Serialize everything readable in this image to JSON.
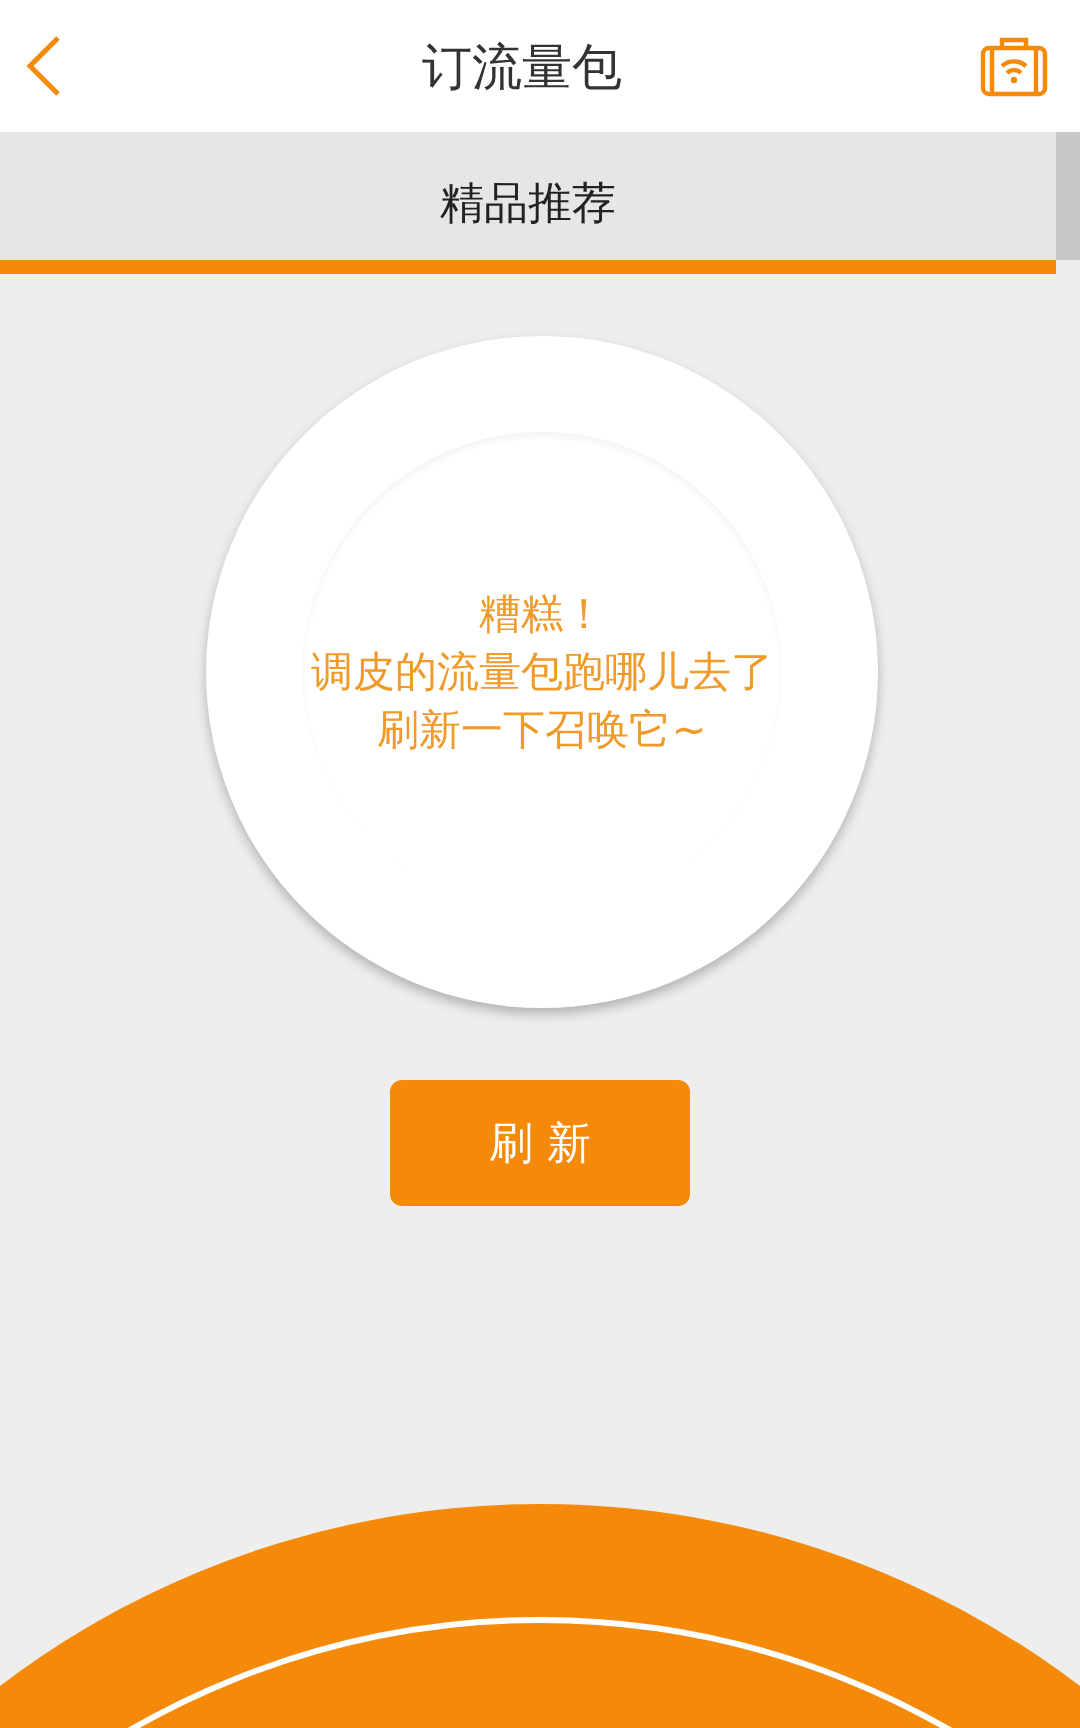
{
  "header": {
    "title": "订流量包"
  },
  "tabs": [
    {
      "label": "精品推荐",
      "selected": true
    }
  ],
  "empty_state": {
    "lines": [
      "糟糕！",
      "调皮的流量包跑哪儿去了",
      "刷新一下召唤它~"
    ]
  },
  "refresh_button": {
    "label": "刷 新"
  }
}
